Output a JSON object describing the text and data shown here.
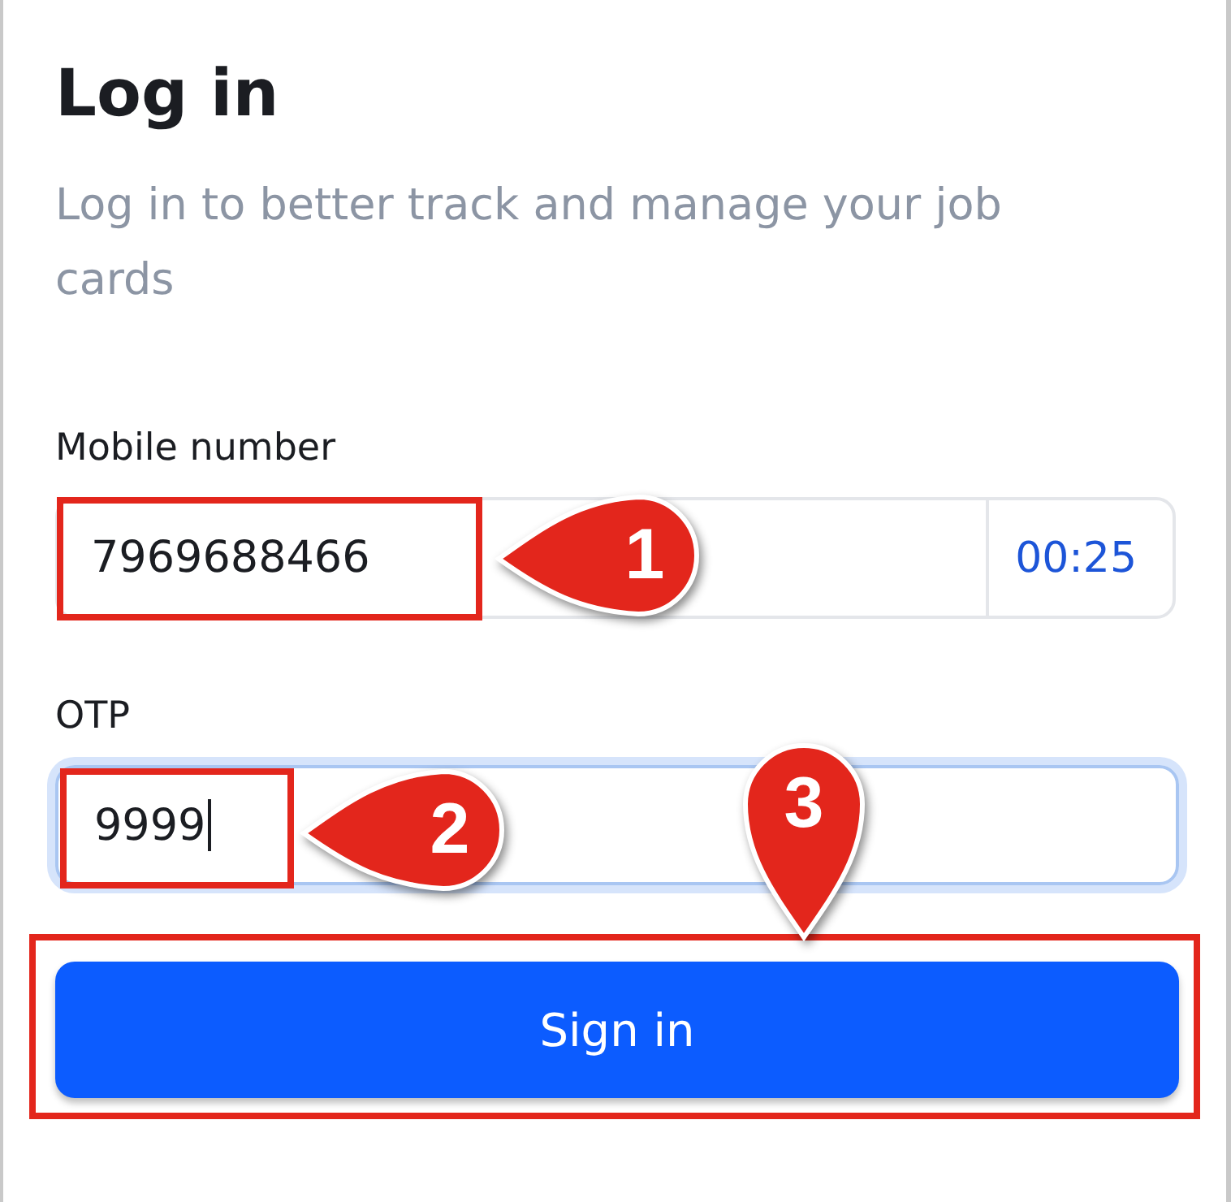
{
  "title": "Log in",
  "subtitle": "Log in to better track and manage your job cards",
  "fields": [
    {
      "kind": "phone",
      "label": "Mobile number",
      "value": "7969688466",
      "timer": "00:25",
      "focused": false,
      "callout": {
        "number": "1",
        "kind": "left"
      }
    },
    {
      "kind": "otp",
      "label": "OTP",
      "value": "9999",
      "focused": true,
      "callout": {
        "number": "2",
        "kind": "left"
      }
    }
  ],
  "button": {
    "label": "Sign in",
    "callout": {
      "number": "3",
      "kind": "down"
    }
  }
}
